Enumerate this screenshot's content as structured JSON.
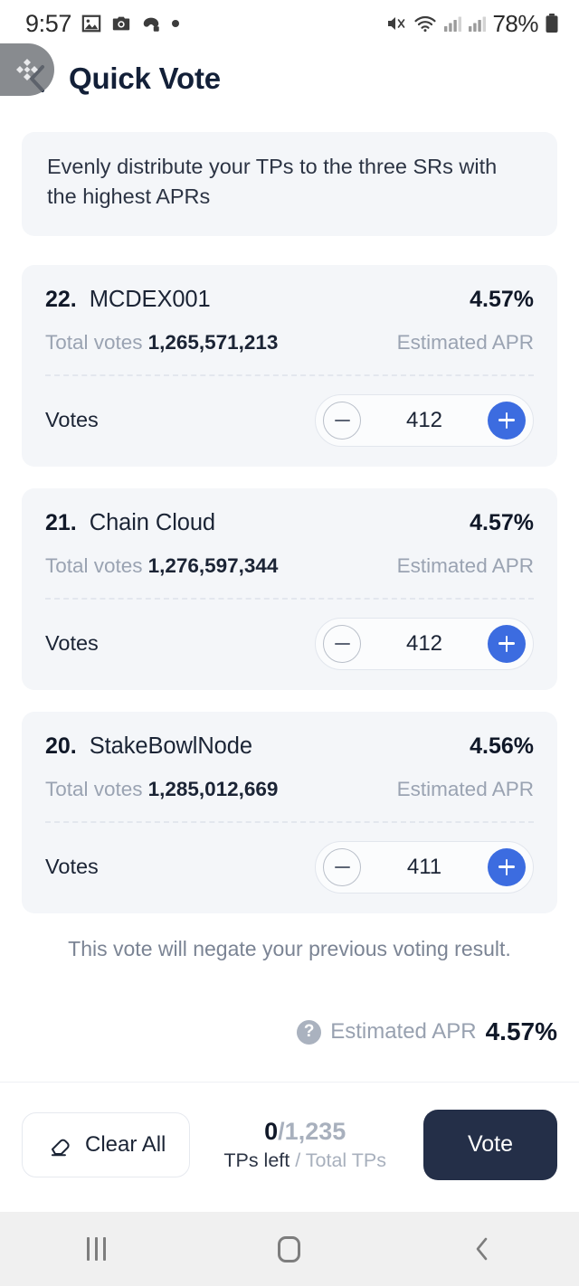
{
  "status_bar": {
    "time": "9:57",
    "battery_text": "78%",
    "left_icons": [
      "image-icon",
      "camera-icon",
      "game-controller-icon",
      "dot-icon"
    ],
    "right_icons": [
      "mute-icon",
      "wifi-icon",
      "signal-1-icon",
      "signal-2-icon",
      "battery-icon"
    ]
  },
  "float_widget": {
    "icon": "diamond-logo-icon"
  },
  "header": {
    "back_icon": "back-chevron-icon",
    "title": "Quick Vote"
  },
  "notice": {
    "text": "Evenly distribute your TPs to the three SRs with the highest APRs"
  },
  "sr_cards": [
    {
      "rank": "22.",
      "name": "MCDEX001",
      "apr": "4.57%",
      "total_votes_label": "Total votes",
      "total_votes_value": "1,265,571,213",
      "apr_label": "Estimated APR",
      "votes_label": "Votes",
      "votes_value": "412"
    },
    {
      "rank": "21.",
      "name": "Chain Cloud",
      "apr": "4.57%",
      "total_votes_label": "Total votes",
      "total_votes_value": "1,276,597,344",
      "apr_label": "Estimated APR",
      "votes_label": "Votes",
      "votes_value": "412"
    },
    {
      "rank": "20.",
      "name": "StakeBowlNode",
      "apr": "4.56%",
      "total_votes_label": "Total votes",
      "total_votes_value": "1,285,012,669",
      "apr_label": "Estimated APR",
      "votes_label": "Votes",
      "votes_value": "411"
    }
  ],
  "negate_note": "This vote will negate your previous voting result.",
  "apr_summary": {
    "help_icon": "question-mark-icon",
    "label": "Estimated APR",
    "value": "4.57%"
  },
  "action_bar": {
    "clear_all_icon": "eraser-icon",
    "clear_all_label": "Clear All",
    "tps_left": "0",
    "tps_separator": "/",
    "tps_total": "1,235",
    "caption_left": "TPs left",
    "caption_sep": " / ",
    "caption_right": "Total TPs",
    "vote_label": "Vote"
  },
  "nav_bar": {
    "recents_icon": "recents-icon",
    "home_icon": "home-icon",
    "back_icon": "nav-back-icon"
  },
  "colors": {
    "accent_blue": "#3c6ce0",
    "vote_dark": "#242f48",
    "card_bg": "#f4f6f9",
    "muted_text": "#9aa3b2",
    "title": "#132038"
  }
}
